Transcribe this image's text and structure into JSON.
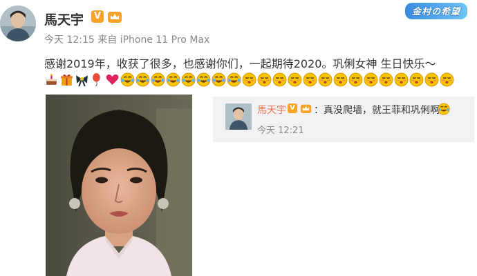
{
  "post": {
    "user_name": "馬天宇",
    "verified_badge": "V",
    "time_label": "今天 12:15 来自 iPhone 11 Pro Max",
    "text": "感谢2019年，收获了很多，也感谢你们，一起期待2020。巩俐女神 生日快乐～",
    "emojis": [
      "cake-icon",
      "gift-icon",
      "bow-icon",
      "balloon-icon",
      "heart-icon",
      "laugh-cry-icon",
      "laugh-cry-icon",
      "laugh-cry-icon",
      "laugh-cry-icon",
      "laugh-cry-icon",
      "laugh-cry-icon",
      "laugh-cry-icon",
      "laugh-cry-icon",
      "kiss-icon",
      "kiss-icon",
      "kiss-icon",
      "kiss-icon",
      "kiss-icon",
      "kiss-icon",
      "kiss-icon",
      "kiss-icon",
      "kiss-icon",
      "kiss-icon",
      "kiss-icon",
      "kiss-icon",
      "kiss-icon",
      "kiss-icon"
    ]
  },
  "watermark": "金村の希望",
  "reply": {
    "user_name": "馬天宇",
    "verified_badge": "V",
    "text": "：真没爬墙，就王菲和巩俐啊",
    "time_label": "今天 12:21"
  },
  "colors": {
    "reply_name": "#eb7350",
    "badge": "#f8a22a",
    "reply_bg": "#f2f2f5"
  }
}
